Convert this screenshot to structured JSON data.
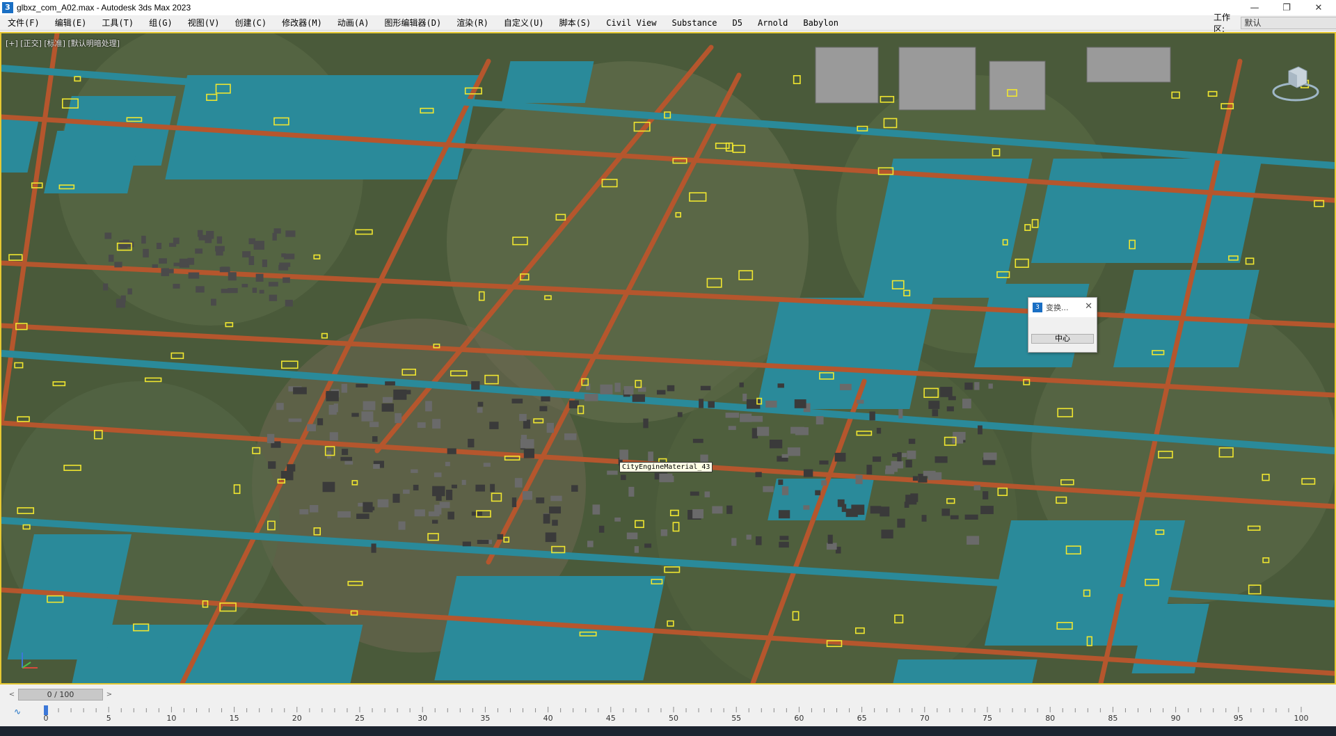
{
  "window": {
    "title": "glbxz_com_A02.max - Autodesk 3ds Max 2023",
    "app_icon": "3",
    "minimize_glyph": "—",
    "maximize_glyph": "❐",
    "close_glyph": "✕"
  },
  "menu": [
    "文件(F)",
    "编辑(E)",
    "工具(T)",
    "组(G)",
    "视图(V)",
    "创建(C)",
    "修改器(M)",
    "动画(A)",
    "图形编辑器(D)",
    "渲染(R)",
    "自定义(U)",
    "脚本(S)",
    "Civil View",
    "Substance",
    "D5",
    "Arnold",
    "Babylon"
  ],
  "workspace": {
    "label": "工作区:",
    "value": "默认"
  },
  "viewport": {
    "label": "[+] [正交] [标准] [默认明暗处理]",
    "tooltip": "CityEngineMaterial_43",
    "colors": {
      "border": "#e5c832",
      "water": "#2a8a9a",
      "road": "#b5562d",
      "terrain": "#4a5a3a",
      "selection": "#f0e630"
    }
  },
  "dialog": {
    "icon": "3",
    "title": "变换...",
    "close_glyph": "✕",
    "center_button": "中心"
  },
  "time_slider": {
    "value": "0 / 100",
    "prev_glyph": "<",
    "next_glyph": ">"
  },
  "trackbar": {
    "curve_icon": "∿",
    "ticks": [
      "0",
      "5",
      "10",
      "15",
      "20",
      "25",
      "30",
      "35",
      "40",
      "45",
      "50",
      "55",
      "60",
      "65",
      "70",
      "75",
      "80",
      "85",
      "90",
      "95",
      "100"
    ],
    "current_frame": 0
  }
}
